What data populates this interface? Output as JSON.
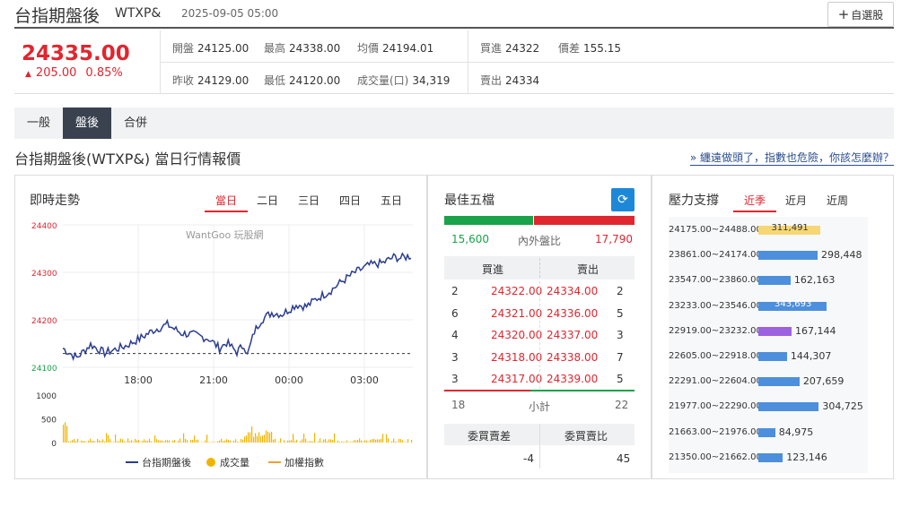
{
  "header": {
    "name": "台指期盤後",
    "code": "WTXP&",
    "time": "2025-09-05 05:00",
    "fav_label": "自選股"
  },
  "quote": {
    "price": "24335.00",
    "change": "205.00",
    "change_pct": "0.85%",
    "fields": [
      {
        "label": "開盤",
        "value": "24125.00"
      },
      {
        "label": "最高",
        "value": "24338.00"
      },
      {
        "label": "均價",
        "value": "24194.01"
      },
      {
        "label": "買進",
        "value": "24322"
      },
      {
        "label": "價差",
        "value": "155.15"
      },
      {
        "label": "昨收",
        "value": "24129.00"
      },
      {
        "label": "最低",
        "value": "24120.00"
      },
      {
        "label": "成交量(口)",
        "value": "34,319"
      },
      {
        "label": "賣出",
        "value": "24334"
      }
    ]
  },
  "tabs": [
    "一般",
    "盤後",
    "合併"
  ],
  "active_tab": "盤後",
  "section_title": "台指期盤後(WTXP&) 當日行情報價",
  "news_link": "» 纏遠做頭了，指數也危險，你該怎麼辦？",
  "intraday": {
    "title": "即時走勢",
    "range_tabs": [
      "當日",
      "二日",
      "三日",
      "四日",
      "五日"
    ],
    "active_range": "當日",
    "watermark": "WantGoo 玩股網",
    "price_ticks": [
      "24400",
      "24300",
      "24200",
      "24100"
    ],
    "vol_ticks": [
      "1000",
      "500",
      "0"
    ],
    "time_ticks": [
      "18:00",
      "21:00",
      "00:00",
      "03:00"
    ],
    "reference_price": 24129,
    "legend": [
      "台指期盤後",
      "成交量",
      "加權指數"
    ],
    "colors": {
      "price_line": "#2b3d8f",
      "volume": "#f0b400",
      "index": "#f0a030",
      "up": "#e0262f",
      "down": "#1aa34a"
    }
  },
  "best_five": {
    "title": "最佳五檔",
    "outer_label": "內外盤比",
    "bid_total_volume": "15,600",
    "ask_total_volume": "17,790",
    "bid_share": 0.467,
    "col_bid": "買進",
    "col_ask": "賣出",
    "rows": [
      {
        "bid_vol": "2",
        "bid": "24322.00",
        "ask": "24334.00",
        "ask_vol": "2"
      },
      {
        "bid_vol": "6",
        "bid": "24321.00",
        "ask": "24336.00",
        "ask_vol": "5"
      },
      {
        "bid_vol": "4",
        "bid": "24320.00",
        "ask": "24337.00",
        "ask_vol": "3"
      },
      {
        "bid_vol": "3",
        "bid": "24318.00",
        "ask": "24338.00",
        "ask_vol": "7"
      },
      {
        "bid_vol": "3",
        "bid": "24317.00",
        "ask": "24339.00",
        "ask_vol": "5"
      }
    ],
    "subtotal_label": "小計",
    "bid_subtotal": "18",
    "ask_subtotal": "22",
    "diff_label": "委買賣差",
    "ratio_label": "委買賣比",
    "diff_value": "-4",
    "ratio_value": "45"
  },
  "pressure": {
    "title": "壓力支撐",
    "tabs": [
      "近季",
      "近月",
      "近周"
    ],
    "active_tab": "近季",
    "max_value": 343693,
    "rows": [
      {
        "range": "24175.00~24488.00",
        "value": 311491,
        "label": "311,491",
        "color": "#f7d774",
        "inside": true
      },
      {
        "range": "23861.00~24174.00",
        "value": 298448,
        "label": "298,448",
        "color": "#4d8fdc",
        "inside": false
      },
      {
        "range": "23547.00~23860.00",
        "value": 162163,
        "label": "162,163",
        "color": "#4d8fdc",
        "inside": false
      },
      {
        "range": "23233.00~23546.00",
        "value": 343693,
        "label": "343,693",
        "color": "#4d8fdc",
        "inside": true
      },
      {
        "range": "22919.00~23232.00",
        "value": 167144,
        "label": "167,144",
        "color": "#9b63e0",
        "inside": false
      },
      {
        "range": "22605.00~22918.00",
        "value": 144307,
        "label": "144,307",
        "color": "#4d8fdc",
        "inside": false
      },
      {
        "range": "22291.00~22604.00",
        "value": 207659,
        "label": "207,659",
        "color": "#4d8fdc",
        "inside": false
      },
      {
        "range": "21977.00~22290.00",
        "value": 304725,
        "label": "304,725",
        "color": "#4d8fdc",
        "inside": false
      },
      {
        "range": "21663.00~21976.00",
        "value": 84975,
        "label": "84,975",
        "color": "#4d8fdc",
        "inside": false
      },
      {
        "range": "21350.00~21662.00",
        "value": 123146,
        "label": "123,146",
        "color": "#4d8fdc",
        "inside": false
      }
    ]
  }
}
